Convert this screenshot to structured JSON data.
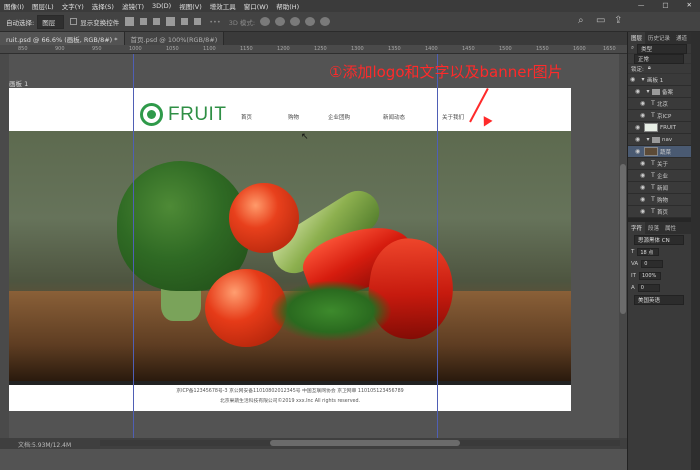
{
  "menu": [
    "图像(I)",
    "图层(L)",
    "文字(Y)",
    "选择(S)",
    "滤镜(T)",
    "3D(D)",
    "视图(V)",
    "增效工具",
    "窗口(W)",
    "帮助(H)"
  ],
  "window_controls": [
    "—",
    "□",
    "✕"
  ],
  "options": {
    "auto_select_label": "自动选择:",
    "auto_select_value": "图层",
    "show_transform_label": "显示变换控件",
    "mode_3d_label": "3D 模式:"
  },
  "tabs": [
    {
      "label": "ruit.psd @ 66.6% (画板, RGB/8#) *"
    },
    {
      "label": "首页.psd @ 100%(RGB/8#)"
    }
  ],
  "ruler_ticks": [
    "850",
    "900",
    "950",
    "1000",
    "1050",
    "1100",
    "1150",
    "1200",
    "1250",
    "1300",
    "1350",
    "1400",
    "1450",
    "1500",
    "1550",
    "1600",
    "1650"
  ],
  "artboard_label": "画板 1",
  "annotation": "①添加logo和文字以及banner图片",
  "site": {
    "logo_text": "FRUIT",
    "nav": [
      "首页",
      "购物",
      "企业团购",
      "新闻动态",
      "关于我们"
    ],
    "footer_line1": "京ICP备12345678号-3 京公网安备11010802012345号  中国互联网协会 京卫网审  110105123456789",
    "footer_line2": "北京果蔬生活科技有限公司©2019 xxx.Inc All rights reserved."
  },
  "status": {
    "doc": "文档:5.93M/12.4M"
  },
  "panel": {
    "tabs": [
      "图层",
      "历史记录",
      "通道"
    ],
    "filter_label": "类型",
    "blend_mode": "正常",
    "lock_label": "锁定:",
    "layers": [
      {
        "type": "▾",
        "name": "画板 1",
        "indent": 0
      },
      {
        "type": "▾",
        "name": "备案",
        "indent": 1
      },
      {
        "type": "T",
        "name": "北京",
        "indent": 2
      },
      {
        "type": "T",
        "name": "京ICP",
        "indent": 2
      },
      {
        "type": "img",
        "name": "FRUIT",
        "indent": 1
      },
      {
        "type": "▾",
        "name": "nav",
        "indent": 1
      },
      {
        "type": "img",
        "name": "蔬菜",
        "indent": 1
      },
      {
        "type": "T",
        "name": "关于",
        "indent": 2
      },
      {
        "type": "T",
        "name": "企业",
        "indent": 2
      },
      {
        "type": "T",
        "name": "新闻",
        "indent": 2
      },
      {
        "type": "T",
        "name": "购物",
        "indent": 2
      },
      {
        "type": "T",
        "name": "首页",
        "indent": 2
      }
    ],
    "char_tabs": [
      "字符",
      "段落",
      "属性"
    ],
    "font_name": "思源黑体 CN",
    "font_size": "18 点",
    "leading": "0",
    "scale": "100%",
    "tracking": "0",
    "lang": "美国英语"
  }
}
